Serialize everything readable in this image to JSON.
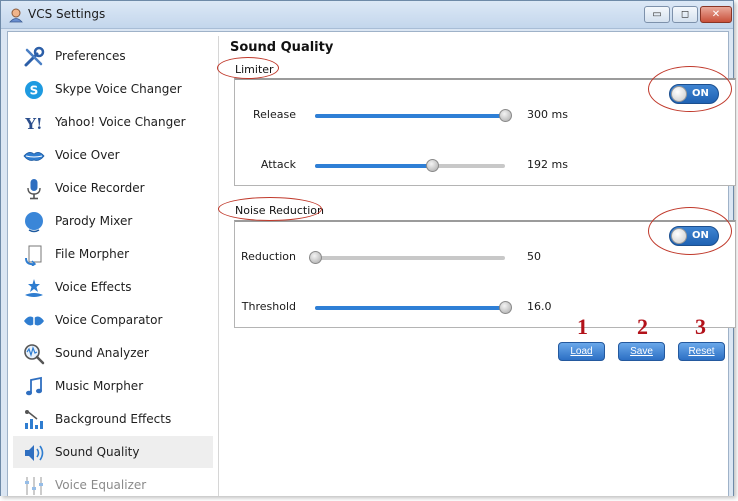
{
  "window": {
    "title": "VCS Settings",
    "controls": {
      "minimize": "▭",
      "maximize": "◻",
      "close": "✕"
    }
  },
  "sidebar": {
    "items": [
      {
        "label": "Preferences",
        "icon": "tools-icon"
      },
      {
        "label": "Skype Voice Changer",
        "icon": "skype-icon"
      },
      {
        "label": "Yahoo! Voice Changer",
        "icon": "yahoo-icon"
      },
      {
        "label": "Voice Over",
        "icon": "lips-icon"
      },
      {
        "label": "Voice Recorder",
        "icon": "microphone-icon"
      },
      {
        "label": "Parody Mixer",
        "icon": "head-icon"
      },
      {
        "label": "File Morpher",
        "icon": "file-morph-icon"
      },
      {
        "label": "Voice Effects",
        "icon": "voice-effects-icon"
      },
      {
        "label": "Voice Comparator",
        "icon": "comparator-icon"
      },
      {
        "label": "Sound Analyzer",
        "icon": "analyzer-icon"
      },
      {
        "label": "Music Morpher",
        "icon": "music-note-icon"
      },
      {
        "label": "Background Effects",
        "icon": "background-effects-icon"
      },
      {
        "label": "Sound Quality",
        "icon": "speaker-icon"
      },
      {
        "label": "Voice Equalizer",
        "icon": "equalizer-icon"
      }
    ],
    "active_index": 12
  },
  "main": {
    "title": "Sound Quality",
    "limiter": {
      "label": "Limiter",
      "toggle": "ON",
      "rows": [
        {
          "label": "Release",
          "value": "300 ms",
          "level": 1.0
        },
        {
          "label": "Attack",
          "value": "192 ms",
          "level": 0.62
        }
      ]
    },
    "noise_reduction": {
      "label": "Noise Reduction",
      "toggle": "ON",
      "rows": [
        {
          "label": "Reduction",
          "value": "50",
          "level": 0.0
        },
        {
          "label": "Threshold",
          "value": "16.0",
          "level": 1.0
        }
      ]
    },
    "buttons": {
      "load": "Load",
      "save": "Save",
      "reset": "Reset"
    },
    "callouts": [
      "1",
      "2",
      "3"
    ]
  },
  "colors": {
    "accent": "#2e7fd6",
    "annotation": "#c0392b",
    "callout": "#b3121a"
  }
}
